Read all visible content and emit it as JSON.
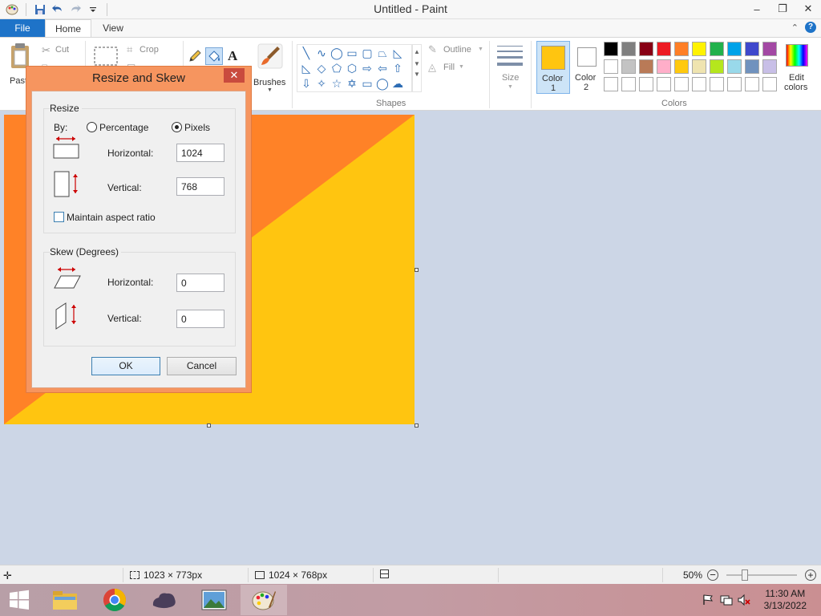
{
  "window": {
    "title": "Untitled - Paint",
    "minimize": "–",
    "maximize": "❐",
    "close": "✕"
  },
  "tabs": {
    "file": "File",
    "home": "Home",
    "view": "View",
    "help": "?"
  },
  "ribbon": {
    "paste": "Past",
    "cut": "Cut",
    "crop": "Crop",
    "brushes": "Brushes",
    "outline": "Outline",
    "fill": "Fill",
    "size": "Size",
    "shapes_group": "Shapes",
    "color1_line1": "Color",
    "color1_line2": "1",
    "color2_line1": "Color",
    "color2_line2": "2",
    "edit_colors_line1": "Edit",
    "edit_colors_line2": "colors",
    "colors_group": "Colors",
    "color1_value": "#ffc510",
    "color2_value": "#ffffff",
    "palette": [
      "#000000",
      "#7f7f7f",
      "#880015",
      "#ed1c24",
      "#ff7f27",
      "#fff200",
      "#22b14c",
      "#00a2e8",
      "#3f48cc",
      "#a349a4",
      "#ffffff",
      "#c3c3c3",
      "#b97a57",
      "#ffaec9",
      "#ffc90e",
      "#efe4b0",
      "#b5e61d",
      "#99d9ea",
      "#7092be",
      "#c8bfe7",
      "#ffffff",
      "#ffffff",
      "#ffffff",
      "#ffffff",
      "#ffffff",
      "#ffffff",
      "#ffffff",
      "#ffffff",
      "#ffffff",
      "#ffffff"
    ]
  },
  "dialog": {
    "title": "Resize and Skew",
    "close": "✕",
    "resize_legend": "Resize",
    "by_label": "By:",
    "percentage_label": "Percentage",
    "pixels_label": "Pixels",
    "selected_unit": "Pixels",
    "resize_horizontal_label": "Horizontal:",
    "resize_horizontal_value": "1024",
    "resize_vertical_label": "Vertical:",
    "resize_vertical_value": "768",
    "maintain_aspect_label": "Maintain aspect ratio",
    "maintain_aspect_checked": false,
    "skew_legend": "Skew (Degrees)",
    "skew_horizontal_label": "Horizontal:",
    "skew_horizontal_value": "0",
    "skew_vertical_label": "Vertical:",
    "skew_vertical_value": "0",
    "ok_label": "OK",
    "cancel_label": "Cancel"
  },
  "statusbar": {
    "selection_size": "1023 × 773px",
    "image_size": "1024 × 768px",
    "zoom": "50%"
  },
  "taskbar": {
    "time": "11:30 AM",
    "date": "3/13/2022"
  },
  "canvas": {
    "background_color": "#ffc510",
    "triangle_color": "#ff8227"
  }
}
